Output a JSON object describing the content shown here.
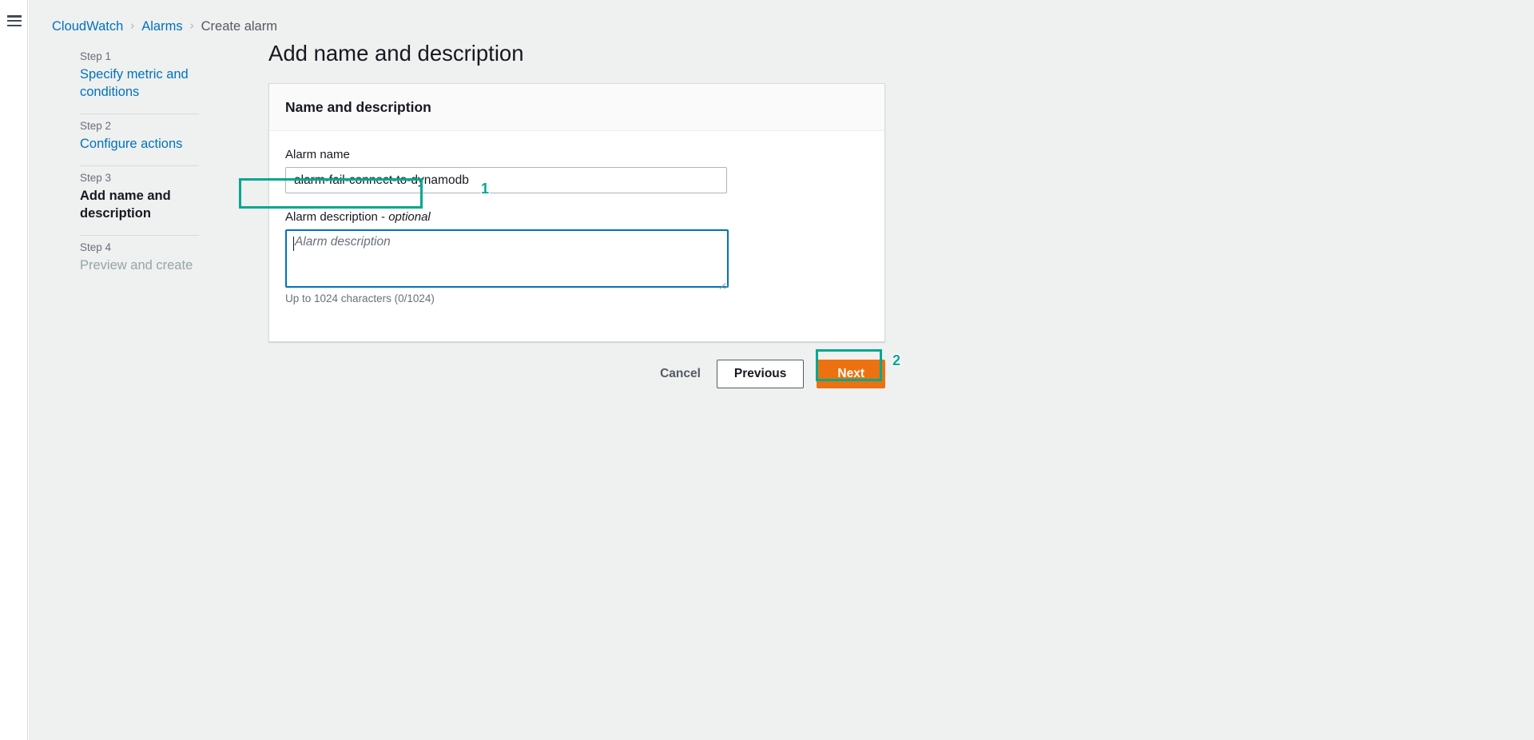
{
  "topbar": {
    "menu_icon": "hamburger-menu-icon"
  },
  "breadcrumb": {
    "items": [
      {
        "label": "CloudWatch",
        "type": "link"
      },
      {
        "label": "Alarms",
        "type": "link"
      },
      {
        "label": "Create alarm",
        "type": "current"
      }
    ],
    "separator": "›"
  },
  "wizard": {
    "steps": [
      {
        "number": "Step 1",
        "title": "Specify metric and conditions",
        "state": "link"
      },
      {
        "number": "Step 2",
        "title": "Configure actions",
        "state": "link"
      },
      {
        "number": "Step 3",
        "title": "Add name and description",
        "state": "active"
      },
      {
        "number": "Step 4",
        "title": "Preview and create",
        "state": "disabled"
      }
    ]
  },
  "main": {
    "page_title": "Add name and description",
    "panel": {
      "header_title": "Name and description",
      "alarm_name": {
        "label": "Alarm name",
        "value": "alarm-fail-connect-to-dynamodb",
        "placeholder": ""
      },
      "alarm_description": {
        "label_text": "Alarm description - ",
        "label_optional": "optional",
        "value": "",
        "placeholder": "Alarm description",
        "hint": "Up to 1024 characters (0/1024)"
      }
    },
    "actions": {
      "cancel_label": "Cancel",
      "previous_label": "Previous",
      "next_label": "Next"
    }
  },
  "annotations": {
    "step_one": "1",
    "step_two": "2"
  },
  "colors": {
    "accent_link": "#0073bb",
    "primary_button": "#ec7211",
    "annotation": "#00a88e",
    "page_background": "#eff0f0",
    "panel_background": "#ffffff"
  }
}
